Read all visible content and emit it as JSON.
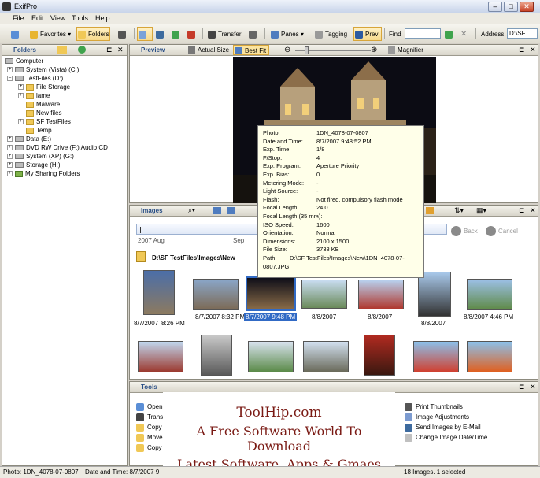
{
  "window": {
    "title": "ExifPro"
  },
  "menu": [
    "File",
    "Edit",
    "View",
    "Tools",
    "Help"
  ],
  "toolbar": {
    "favorites": "Favorites",
    "folders": "Folders",
    "transfer": "Transfer",
    "panes": "Panes",
    "tagging": "Tagging",
    "preview": "Prev",
    "find_label": "Find",
    "address_label": "Address",
    "address_value": "D:\\SF"
  },
  "folders_pane": {
    "title": "Folders",
    "tree": [
      "Computer",
      "System (Vista) (C:)",
      "TestFiles (D:)",
      "File Storage",
      "lame",
      "Malware",
      "New files",
      "SF TestFiles",
      "Temp",
      "Data (E:)",
      "DVD RW Drive (F:) Audio CD",
      "System (XP) (G:)",
      "Storage (H:)",
      "My Sharing Folders"
    ]
  },
  "preview_pane": {
    "title": "Preview",
    "actual_size": "Actual Size",
    "best_fit": "Best Fit",
    "magnifier": "Magnifier"
  },
  "info": [
    {
      "k": "Photo:",
      "v": "1DN_4078-07-0807"
    },
    {
      "k": "Date and Time:",
      "v": "8/7/2007  9:48:52 PM"
    },
    {
      "k": "Exp. Time:",
      "v": "1/8"
    },
    {
      "k": "F/Stop:",
      "v": "4"
    },
    {
      "k": "Exp. Program:",
      "v": "Aperture Priority"
    },
    {
      "k": "Exp. Bias:",
      "v": "0"
    },
    {
      "k": "Metering Mode:",
      "v": "-"
    },
    {
      "k": "Light Source:",
      "v": "-"
    },
    {
      "k": "Flash:",
      "v": "Not fired, compulsory flash mode"
    },
    {
      "k": "Focal Length:",
      "v": "24.0"
    },
    {
      "k": "Focal Length (35 mm):",
      "v": "-"
    },
    {
      "k": "ISO Speed:",
      "v": "1600"
    },
    {
      "k": "Orientation:",
      "v": "Normal"
    },
    {
      "k": "Dimensions:",
      "v": "2100 x 1500"
    },
    {
      "k": "File Size:",
      "v": "3738 KB"
    }
  ],
  "info_path": {
    "k": "Path:",
    "v": "D:\\SF TestFiles\\Images\\New\\1DN_4078-07-",
    "v2": "0807.JPG"
  },
  "images_pane": {
    "title": "Images",
    "back": "Back",
    "cancel": "Cancel",
    "timeline_year": "2007 Aug",
    "timeline_sep": "Sep",
    "path": "D:\\SF TestFiles\\Images\\New"
  },
  "thumb_captions": [
    "8/7/2007\n8:26 PM",
    "8/7/2007  8:32 PM",
    "8/7/2007  9:48 PM",
    "8/8/2007",
    "8/8/2007",
    "8/8/2007",
    "8/8/2007  4:46 PM"
  ],
  "caption_top": [
    "8/7/2007",
    "8/7/2007  8:32 PM",
    "8/7/2007  9:48 PM",
    "8/8/2007",
    "8/8/2007",
    "8/8/2007",
    "8/8/2007  4:46 PM"
  ],
  "caption_bottom": [
    "8:26 PM"
  ],
  "tools_pane": {
    "title": "Tools",
    "left": [
      "Open",
      "Trans",
      "Copy",
      "Move",
      "Copy"
    ],
    "right": [
      "Print Thumbnails",
      "Image Adjustments",
      "Send Images by E-Mail",
      "Change Image Date/Time"
    ]
  },
  "overlay": {
    "l1": "ToolHip.com",
    "l2": "A Free Software World To Download",
    "l3": "Latest Software, Apps & Gmaes"
  },
  "status": {
    "photo": "Photo: 1DN_4078-07-0807",
    "date": "Date and Time: 8/7/2007  9",
    "count": "18 Images. 1 selected"
  }
}
